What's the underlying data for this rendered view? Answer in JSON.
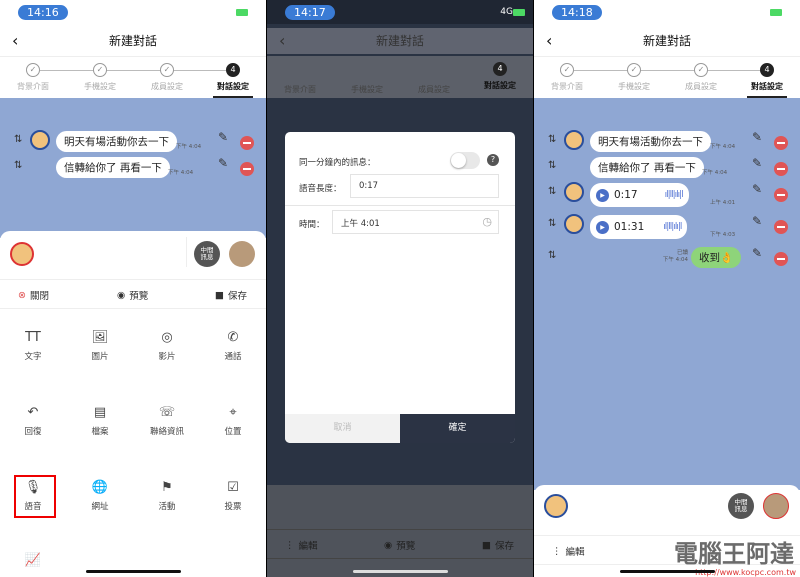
{
  "title": "新建對話",
  "steps": [
    "背景介面",
    "手機設定",
    "成員設定",
    "對話設定"
  ],
  "step_active": "4",
  "colors": {
    "chat_bg": "#8fa7d3",
    "delete": "#e05555",
    "accent": "#3a7bd5",
    "highlight": "#e00000"
  },
  "panel1": {
    "time": "14:16",
    "messages": [
      {
        "text": "明天有場活動你去一下",
        "time": "下午 4:04"
      },
      {
        "text": "信轉給你了 再看一下",
        "time": "下午 4:04"
      }
    ],
    "middle_label": "中間\n訊息",
    "actions": {
      "close": "關閉",
      "preview": "預覽",
      "save": "保存"
    },
    "grid": [
      {
        "icon": "text-icon",
        "glyph": "TT",
        "label": "文字"
      },
      {
        "icon": "image-icon",
        "glyph": "🖼",
        "label": "圖片"
      },
      {
        "icon": "video-icon",
        "glyph": "◎",
        "label": "影片"
      },
      {
        "icon": "call-icon",
        "glyph": "✆",
        "label": "通話"
      },
      {
        "icon": "reply-icon",
        "glyph": "↶",
        "label": "回復"
      },
      {
        "icon": "file-icon",
        "glyph": "▤",
        "label": "檔案"
      },
      {
        "icon": "contact-icon",
        "glyph": "☏",
        "label": "聯絡資訊"
      },
      {
        "icon": "location-icon",
        "glyph": "⌖",
        "label": "位置"
      },
      {
        "icon": "mic-icon",
        "glyph": "🎙",
        "label": "語音"
      },
      {
        "icon": "globe-icon",
        "glyph": "🌐",
        "label": "網址"
      },
      {
        "icon": "event-icon",
        "glyph": "⚑",
        "label": "活動"
      },
      {
        "icon": "vote-icon",
        "glyph": "☑",
        "label": "投票"
      },
      {
        "icon": "chart-icon",
        "glyph": "📈",
        "label": ""
      }
    ]
  },
  "panel2": {
    "time": "14:17",
    "network": "4G",
    "modal": {
      "same_minute_label": "同一分鐘內的訊息：",
      "help": "?",
      "duration_label": "語音長度：",
      "duration_value": "0:17",
      "time_label": "時間：",
      "time_value": "上午 4:01",
      "cancel": "取消",
      "confirm": "確定"
    },
    "actions": {
      "edit": "編輯",
      "preview": "預覽",
      "save": "保存"
    }
  },
  "panel3": {
    "time": "14:18",
    "messages": [
      {
        "text": "明天有場活動你去一下",
        "time": "下午 4:04"
      },
      {
        "text": "信轉給你了 再看一下",
        "time": "下午 4:04"
      },
      {
        "duration": "0:17",
        "time": "上午 4:01"
      },
      {
        "duration": "01:31",
        "time": "下午 4:03"
      },
      {
        "text": "收到👌",
        "time": "下午 4:04",
        "read": "已讀"
      }
    ],
    "middle_label": "中間\n訊息",
    "actions": {
      "edit": "編輯"
    },
    "watermark": "電腦王阿達",
    "watermark_url": "http://www.kocpc.com.tw"
  }
}
